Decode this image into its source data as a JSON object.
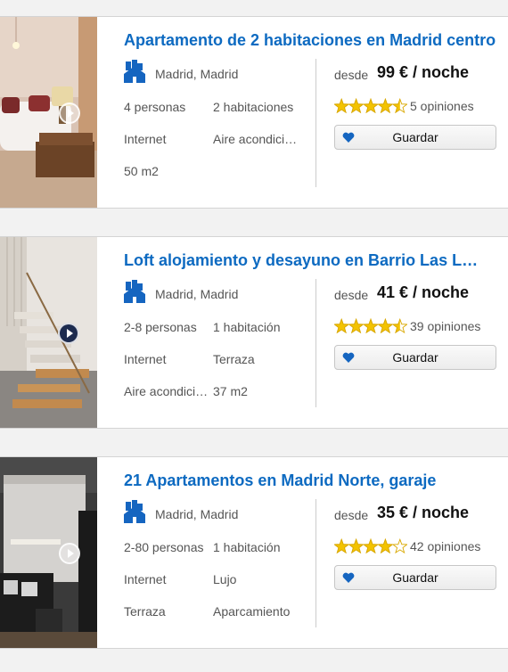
{
  "listings": [
    {
      "title": "Apartamento de 2 habitaciones en Madrid centro",
      "location": "Madrid, Madrid",
      "features": [
        "4 personas",
        "2 habitaciones",
        "Internet",
        "Aire acondicionado",
        "50 m2"
      ],
      "price_prefix": "desde",
      "price": "99 € / noche",
      "rating": 4.5,
      "reviews": "5 opiniones",
      "save_label": "Guardar",
      "video_button": "light"
    },
    {
      "title": "Loft alojamiento y desayuno en Barrio Las Letras",
      "location": "Madrid, Madrid",
      "features": [
        "2-8 personas",
        "1 habitación",
        "Internet",
        "Terraza",
        "Aire acondicionado",
        "37 m2"
      ],
      "price_prefix": "desde",
      "price": "41 € / noche",
      "rating": 4.5,
      "reviews": "39 opiniones",
      "save_label": "Guardar",
      "video_button": "dark"
    },
    {
      "title": "21 Apartamentos en Madrid Norte, garaje",
      "location": "Madrid, Madrid",
      "features": [
        "2-80 personas",
        "1 habitación",
        "Internet",
        "Lujo",
        "Terraza",
        "Aparcamiento"
      ],
      "price_prefix": "desde",
      "price": "35 € / noche",
      "rating": 4,
      "reviews": "42 opiniones",
      "save_label": "Guardar",
      "video_button": "light"
    }
  ],
  "colors": {
    "title_blue": "#0d6ac1",
    "icon_blue": "#1565c0",
    "star_gold": "#f3c300",
    "divider": "#cccccc",
    "background": "#f2f2f2"
  },
  "icons": {
    "location": "house-building-icon",
    "favorite": "heart-icon",
    "video": "play-icon",
    "rating": "star-icon"
  }
}
